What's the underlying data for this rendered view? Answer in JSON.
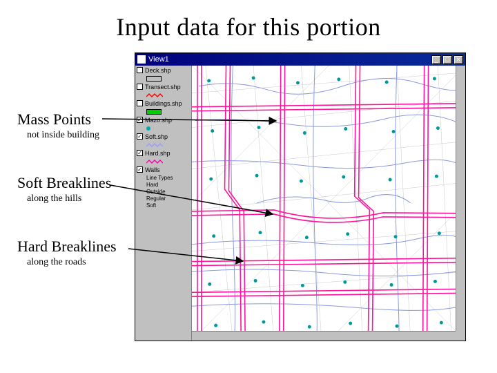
{
  "title": "Input data for this portion",
  "annotations": {
    "mass": {
      "label": "Mass Points",
      "sub": "not inside building"
    },
    "soft": {
      "label": "Soft Breaklines",
      "sub": "along the hills"
    },
    "hard": {
      "label": "Hard Breaklines",
      "sub": "along the roads"
    }
  },
  "window": {
    "caption": "View1",
    "minimize_icon": "_",
    "maximize_icon": "□",
    "close_icon": "×"
  },
  "layers": [
    {
      "name": "Deck.shp",
      "checked": false,
      "symbol": {
        "kind": "rect",
        "fill": "#ffffff"
      }
    },
    {
      "name": "Transect.shp",
      "checked": false,
      "symbol": {
        "kind": "zig",
        "stroke": "#ff0000"
      }
    },
    {
      "name": "Buildings.shp",
      "checked": false,
      "symbol": {
        "kind": "rect",
        "fill": "#00cc00"
      }
    },
    {
      "name": "Mazo.shp",
      "checked": true,
      "symbol": {
        "kind": "dot",
        "fill": "#00aaaa"
      }
    },
    {
      "name": "Soft.shp",
      "checked": true,
      "symbol": {
        "kind": "zig",
        "stroke": "#9999ff"
      }
    },
    {
      "name": "Hard.shp",
      "checked": true,
      "symbol": {
        "kind": "zig",
        "stroke": "#ff00aa"
      }
    },
    {
      "name": "Walls",
      "checked": true,
      "symbol": null
    }
  ],
  "line_types": {
    "heading": "Line Types",
    "items": [
      "Hard",
      "Outside",
      "Regular",
      "Soft"
    ]
  },
  "colors": {
    "soft_lines": "#8899dd",
    "hard_lines": "#ff1199",
    "points": "#009999",
    "tin": "#b0b0b0"
  }
}
